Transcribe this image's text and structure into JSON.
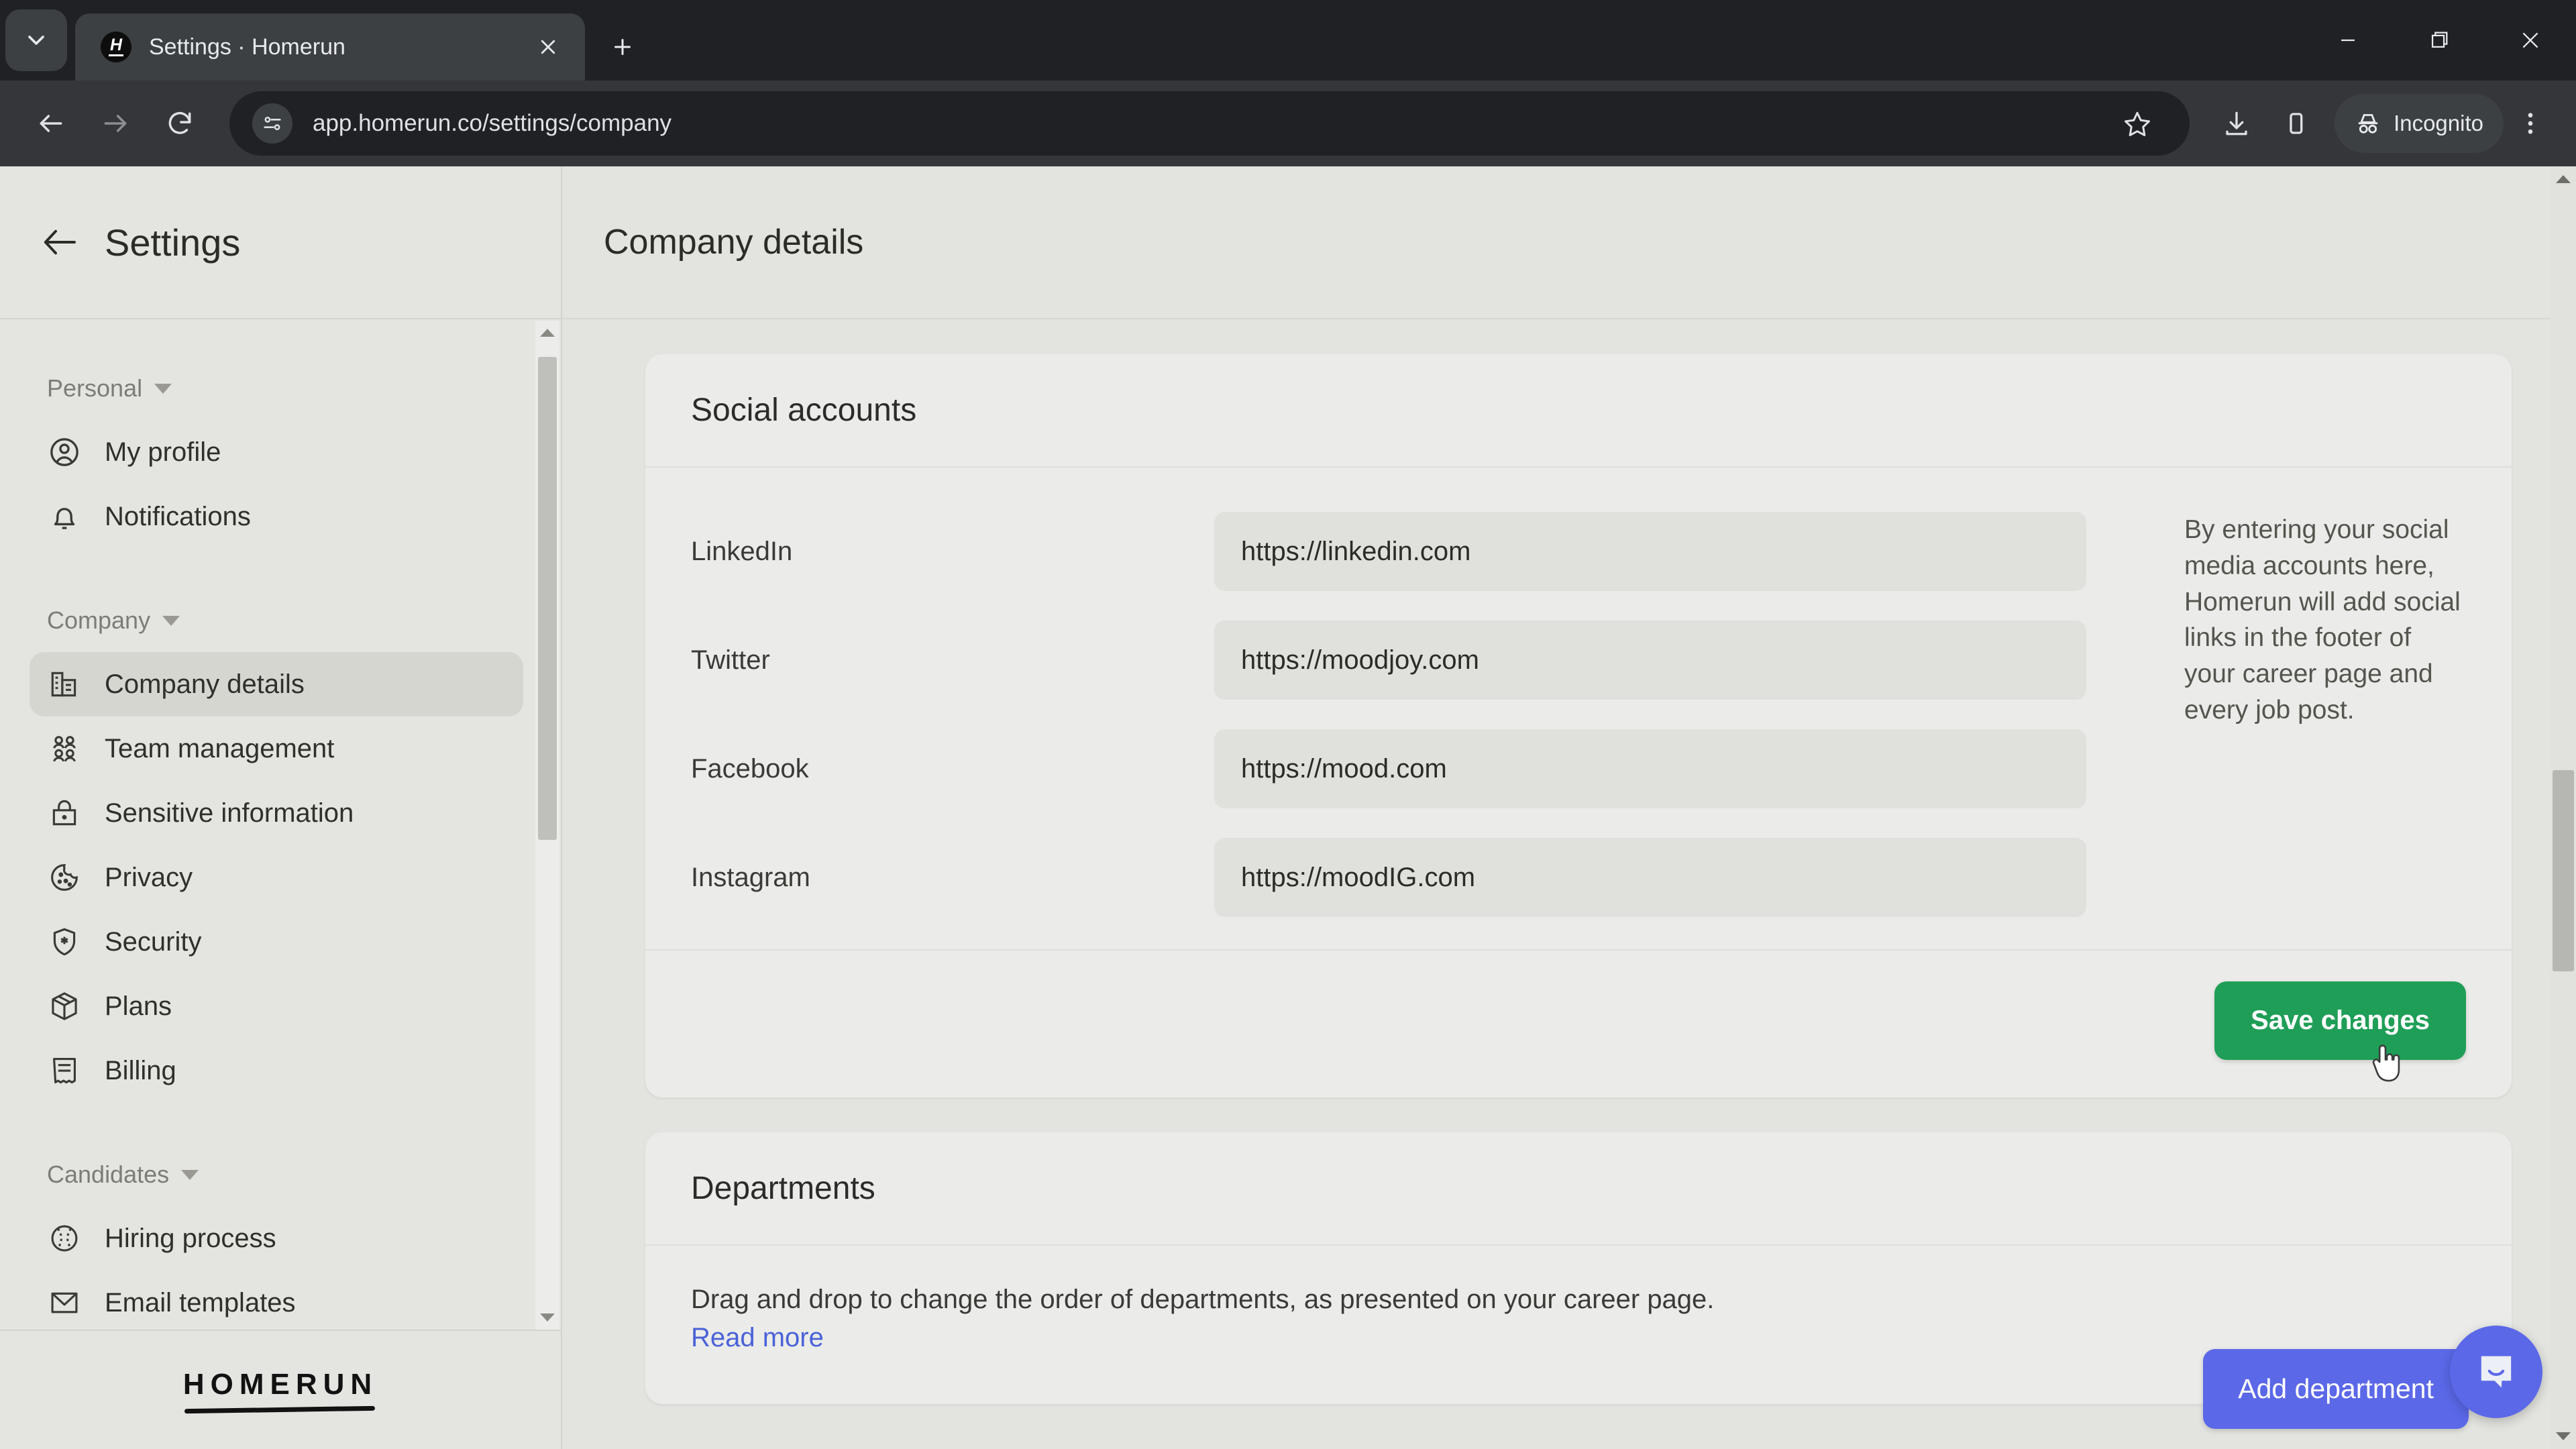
{
  "browser": {
    "tab": {
      "title": "Settings · Homerun",
      "favicon_letter": "H",
      "favicon_name": "homerun-favicon"
    },
    "new_tab_label": "+",
    "url": "app.homerun.co/settings/company",
    "profile_label": "Incognito",
    "icons": {
      "tab_search": "chevron-down-icon",
      "tab_close": "close-icon",
      "back": "back-arrow-icon",
      "forward": "forward-arrow-icon",
      "reload": "reload-icon",
      "site_info": "tune-sliders-icon",
      "bookmark": "star-icon",
      "downloads": "download-icon",
      "side_panel": "side-panel-icon",
      "incognito": "incognito-hat-icon",
      "menu": "three-dots-menu-icon",
      "minimize": "minimize-icon",
      "maximize": "restore-icon",
      "close_window": "close-window-icon"
    }
  },
  "sidebar": {
    "title": "Settings",
    "back_icon": "left-arrow-icon",
    "groups": [
      {
        "label": "Personal",
        "items": [
          {
            "label": "My profile",
            "icon": "user-circle-icon",
            "active": false
          },
          {
            "label": "Notifications",
            "icon": "bell-icon",
            "active": false
          }
        ]
      },
      {
        "label": "Company",
        "items": [
          {
            "label": "Company details",
            "icon": "building-icon",
            "active": true
          },
          {
            "label": "Team management",
            "icon": "people-group-icon",
            "active": false
          },
          {
            "label": "Sensitive information",
            "icon": "lock-icon",
            "active": false
          },
          {
            "label": "Privacy",
            "icon": "cookie-icon",
            "active": false
          },
          {
            "label": "Security",
            "icon": "shield-star-icon",
            "active": false
          },
          {
            "label": "Plans",
            "icon": "package-box-icon",
            "active": false
          },
          {
            "label": "Billing",
            "icon": "receipt-icon",
            "active": false
          }
        ]
      },
      {
        "label": "Candidates",
        "items": [
          {
            "label": "Hiring process",
            "icon": "baseball-icon",
            "active": false
          },
          {
            "label": "Email templates",
            "icon": "envelope-icon",
            "active": false
          }
        ]
      }
    ],
    "logo": "HOMERUN"
  },
  "main": {
    "page_title": "Company details",
    "social_card": {
      "title": "Social accounts",
      "fields": [
        {
          "label": "LinkedIn",
          "value": "https://linkedin.com"
        },
        {
          "label": "Twitter",
          "value": "https://moodjoy.com"
        },
        {
          "label": "Facebook",
          "value": "https://mood.com"
        },
        {
          "label": "Instagram",
          "value": "https://moodIG.com"
        }
      ],
      "note": "By entering your social media accounts here, Homerun will add social links in the footer of your career page and every job post.",
      "save_label": "Save changes"
    },
    "departments_card": {
      "title": "Departments",
      "description": "Drag and drop to change the order of departments, as presented on your career page. ",
      "link_label": "Read more",
      "add_label": "Add department"
    },
    "intercom_icon": "chat-bubble-smile-icon"
  },
  "colors": {
    "accent_green": "#1f9e57",
    "accent_blue": "#5b68e8",
    "link_blue": "#4a62d8",
    "page_bg": "#e3e3df",
    "card_bg": "#ebebe9",
    "sidebar_bg": "#e4e4e0"
  }
}
